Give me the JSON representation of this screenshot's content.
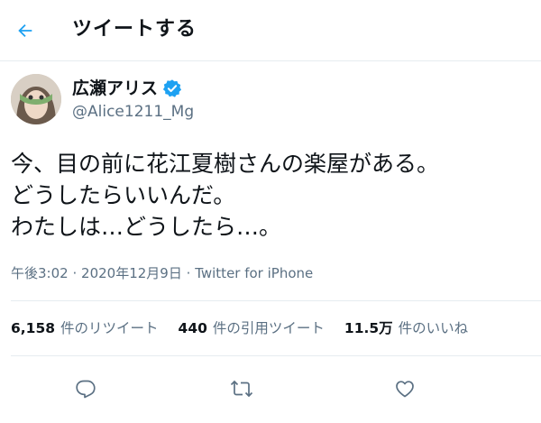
{
  "header": {
    "title": "ツイートする",
    "back_icon": "back-arrow-icon"
  },
  "tweet": {
    "author_name": "広瀬アリス",
    "author_handle": "@Alice1211_Mg",
    "verified_icon": "verified-badge-icon",
    "text": "今、目の前に花江夏樹さんの楽屋がある。\nどうしたらいいんだ。\nわたしは…どうしたら…。",
    "time": "午後3:02",
    "date": "2020年12月9日",
    "source": "Twitter for iPhone",
    "separator": "·"
  },
  "stats": {
    "retweets": {
      "count": "6,158",
      "label": "件のリツイート"
    },
    "quotes": {
      "count": "440",
      "label": "件の引用ツイート"
    },
    "likes": {
      "count": "11.5万",
      "label": "件のいいね"
    }
  },
  "actions": {
    "reply_icon": "reply-icon",
    "retweet_icon": "retweet-icon",
    "like_icon": "like-icon"
  },
  "colors": {
    "accent": "#1da1f2",
    "secondary_text": "#5b7083",
    "divider": "#e6ecf0"
  }
}
